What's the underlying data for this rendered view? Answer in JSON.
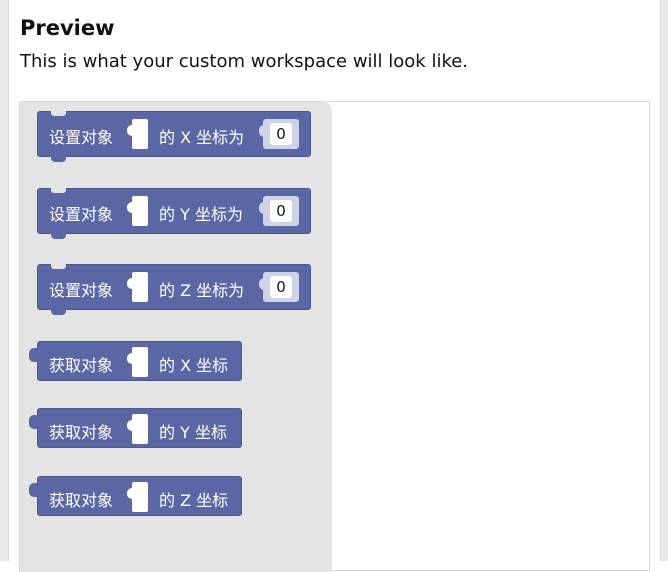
{
  "preview": {
    "title": "Preview",
    "subtitle": "This is what your custom workspace will look like."
  },
  "block_color": "#5b67a5",
  "flyout_color": "#e4e4e4",
  "blocks": [
    {
      "kind": "setter",
      "prefix": "设置对象",
      "suffix": "的 X 坐标为",
      "value": "0"
    },
    {
      "kind": "setter",
      "prefix": "设置对象",
      "suffix": "的 Y 坐标为",
      "value": "0"
    },
    {
      "kind": "setter",
      "prefix": "设置对象",
      "suffix": "的 Z 坐标为",
      "value": "0"
    },
    {
      "kind": "getter",
      "prefix": "获取对象",
      "suffix": "的 X 坐标"
    },
    {
      "kind": "getter",
      "prefix": "获取对象",
      "suffix": "的 Y 坐标"
    },
    {
      "kind": "getter",
      "prefix": "获取对象",
      "suffix": "的 Z 坐标"
    }
  ]
}
